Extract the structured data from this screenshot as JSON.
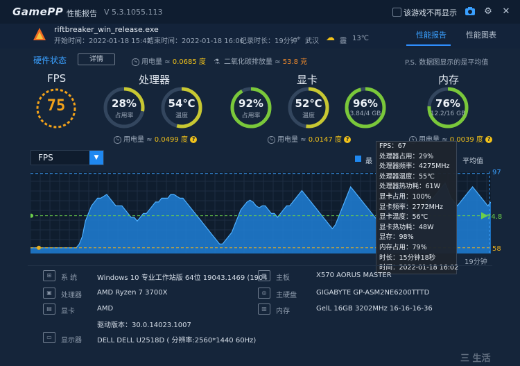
{
  "titlebar": {
    "logo": "GamePP",
    "title": "性能报告",
    "version": "V 5.3.1055.113",
    "hide_in_game_label": "该游戏不再显示"
  },
  "header": {
    "exe_name": "riftbreaker_win_release.exe",
    "start_time": "开始时间：2022-01-18 15:47",
    "end_time": "结束时间：2022-01-18 16:06",
    "duration": "记录时长：19分钟",
    "location": "武汉",
    "weather": "霾",
    "temperature": "13℃",
    "tabs": [
      {
        "label": "性能报告",
        "active": true
      },
      {
        "label": "性能图表",
        "active": false
      }
    ]
  },
  "summary": {
    "section_title": "硬件状态",
    "detail_button": "详情",
    "power_label": "用电量 ≈",
    "power_value": "0.0685 度",
    "co2_label": "二氧化碳排放量 ≈",
    "co2_value": "53.8 克",
    "note": "P.S. 数据图显示的是平均值"
  },
  "fps": {
    "label": "FPS",
    "value": "75"
  },
  "cpu": {
    "label": "处理器",
    "usage": {
      "value": "28%",
      "caption": "占用率",
      "level": 0.28
    },
    "temp": {
      "value": "54℃",
      "caption": "温度",
      "level": 0.54
    },
    "power_label": "用电量 ≈",
    "power_value": "0.0499 度"
  },
  "gpu": {
    "label": "显卡",
    "usage": {
      "value": "92%",
      "caption": "占用率",
      "level": 0.92
    },
    "temp": {
      "value": "52℃",
      "caption": "温度",
      "level": 0.52
    },
    "vram": {
      "value": "96%",
      "caption": "3.84/4 GB",
      "level": 0.96
    },
    "power_label": "用电量 ≈",
    "power_value": "0.0147 度"
  },
  "memory": {
    "label": "内存",
    "usage": {
      "value": "76%",
      "caption": "12.2/16 GB",
      "level": 0.76
    },
    "power_label": "用电量 ≈",
    "power_value": "0.0039 度"
  },
  "chart": {
    "selector": "FPS",
    "legend_max": "最",
    "legend_avg": "平均值",
    "tick_max": "97",
    "tick_avg": "74.8",
    "tick_min": "58",
    "x_label": "19分钟"
  },
  "chart_data": {
    "type": "area",
    "title": "",
    "xlabel": "",
    "ylabel": "",
    "series": [
      {
        "name": "FPS",
        "values": [
          58,
          58,
          58,
          58,
          58,
          58,
          58,
          58,
          58,
          58,
          58,
          58,
          58,
          58,
          58,
          58,
          60,
          64,
          72,
          76,
          80,
          82,
          84,
          84,
          85,
          86,
          84,
          82,
          80,
          80,
          80,
          78,
          76,
          74,
          74,
          72,
          74,
          76,
          76,
          78,
          80,
          82,
          82,
          84,
          84,
          84,
          86,
          86,
          85,
          84,
          84,
          82,
          80,
          78,
          76,
          74,
          72,
          70,
          68,
          66,
          64,
          62,
          60,
          60,
          62,
          64,
          66,
          70,
          74,
          78,
          80,
          82,
          83,
          82,
          80,
          79,
          80,
          80,
          78,
          76,
          76,
          74,
          76,
          78,
          80,
          80,
          82,
          84,
          86,
          88,
          86,
          84,
          82,
          80,
          78,
          76,
          74,
          72,
          70,
          68,
          70,
          74,
          78,
          82,
          86,
          90,
          88,
          86,
          84,
          82,
          80,
          78,
          76,
          74,
          72,
          72,
          74,
          78,
          82,
          86,
          90,
          92,
          88,
          84,
          80,
          78,
          76,
          76,
          78,
          80,
          82,
          84,
          84,
          86,
          88,
          90,
          92,
          88,
          84,
          82,
          80,
          82,
          84,
          86,
          88,
          90,
          88,
          86,
          84,
          82,
          80,
          82
        ]
      }
    ],
    "y_max": 97,
    "y_avg": 74.8,
    "y_min": 58
  },
  "tooltip": {
    "lines": [
      "FPS：67",
      "处理器占用：29%",
      "处理器频率：4275MHz",
      "处理器温度：55℃",
      "处理器热功耗：61W",
      "显卡占用：100%",
      "显卡频率：2772MHz",
      "显卡温度：56℃",
      "显卡热功耗：48W",
      "显存：98%",
      "内存占用：79%",
      "时长：15分钟18秒",
      "时间：2022-01-18 16:02"
    ]
  },
  "system": {
    "os_label": "系 统",
    "os_value": "Windows 10 专业工作站版 64位  19043.1469 (1904",
    "cpu_label": "处理器",
    "cpu_value": "AMD Ryzen 7 3700X",
    "gpu_label": "显卡",
    "gpu_value": "AMD",
    "driver_value": "驱动版本：30.0.14023.1007",
    "monitor_label": "显示器",
    "monitor_value": "DELL DELL U2518D ( 分辨率:2560*1440 60Hz)",
    "board_label": "主板",
    "board_value": "X570 AORUS MASTER",
    "gpu_board_label": "主硬盘",
    "gpu_board_value": "GIGABYTE GP-ASM2NE6200TTTD",
    "mem_label": "内存",
    "mem_value": "GelL 16GB 3202MHz 16-16-16-36"
  },
  "watermark": "三 生活",
  "colors": {
    "accent": "#2f8fff",
    "fps_ring": "#f2a21a",
    "cpu_ring": "#c8c832",
    "gpu_ring": "#7ac83a",
    "chart_fill": "#1f7fd6",
    "max_line": "#3aa0ff",
    "avg_line": "#6ccf4a",
    "min_line": "#e8b020"
  }
}
